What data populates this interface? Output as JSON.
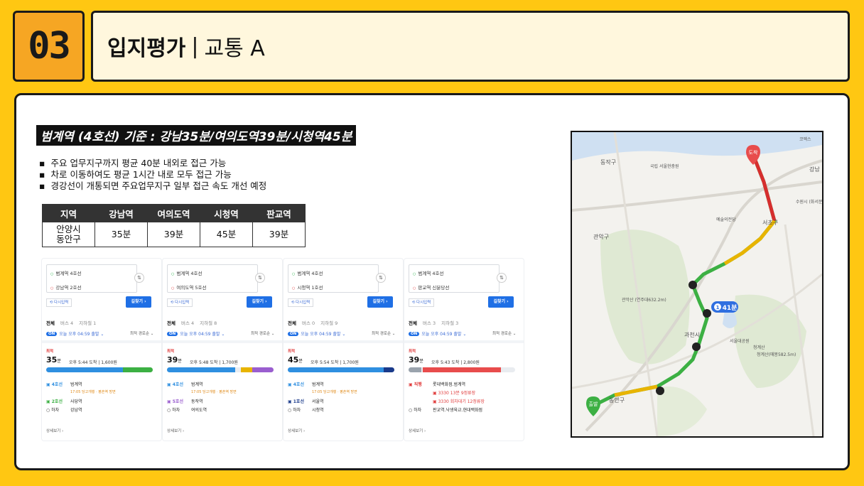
{
  "header": {
    "number": "03",
    "title_bold": "입지평가",
    "title_sep": "|",
    "title_light": "교통 A"
  },
  "headline": "범계역 (4호선) 기준 : 강남35분/여의도역39분/시청역45분",
  "bullets": [
    "주요 업무지구까지 평균 40분 내외로 접근 가능",
    "차로 이동하여도 평균 1시간 내로 모두 접근 가능",
    "경강선이 개통되면 주요업무지구 일부 접근 속도 개선 예정"
  ],
  "table": {
    "headers": [
      "지역",
      "강남역",
      "여의도역",
      "시청역",
      "판교역"
    ],
    "row": {
      "region_line1": "안양시",
      "region_line2": "동안구",
      "values": [
        "35분",
        "39분",
        "45분",
        "39분"
      ]
    }
  },
  "cards": [
    {
      "from": "범계역 4호선",
      "to": "강남역 2호선",
      "swap": "⇅",
      "retry": "⟲ 다시입력",
      "go": "길찾기 ›",
      "tabs": [
        "전체",
        "버스 4",
        "지하철 1"
      ],
      "depart_pill": "ON",
      "depart": "오늘 오후 04:59 출발 ⌄",
      "option": "최적 경로순 ⌄",
      "best": "최적",
      "duration": "35",
      "duration_unit": "분",
      "arrive": "오후 5:44 도착 | 1,600원",
      "stops": [
        {
          "line": "▣ 4호선",
          "name": "범계역",
          "sub": ""
        },
        {
          "line": "",
          "name": "",
          "sub": "17:05 당고개행 · 평촌역 방면"
        },
        {
          "line": "▣ 2호선",
          "name": "사당역",
          "sub": ""
        },
        {
          "line": "○ 하차",
          "name": "강남역",
          "sub": ""
        }
      ],
      "more": "상세보기 ›"
    },
    {
      "from": "범계역 4호선",
      "to": "여의도역 5호선",
      "swap": "⇅",
      "retry": "⟲ 다시입력",
      "go": "길찾기 ›",
      "tabs": [
        "전체",
        "버스 4",
        "지하철 8"
      ],
      "depart_pill": "ON",
      "depart": "오늘 오후 04:59 출발 ⌄",
      "option": "최적 경로순 ⌄",
      "best": "최적",
      "duration": "39",
      "duration_unit": "분",
      "arrive": "오후 5:48 도착 | 1,700원",
      "stops": [
        {
          "line": "▣ 4호선",
          "name": "범계역",
          "sub": ""
        },
        {
          "line": "",
          "name": "",
          "sub": "17:05 당고개행 · 평촌역 방면"
        },
        {
          "line": "▣ 5호선",
          "name": "동작역",
          "sub": ""
        },
        {
          "line": "○ 하차",
          "name": "여의도역",
          "sub": ""
        }
      ],
      "more": "상세보기 ›"
    },
    {
      "from": "범계역 4호선",
      "to": "시청역 1호선",
      "swap": "⇅",
      "retry": "⟲ 다시입력",
      "go": "길찾기 ›",
      "tabs": [
        "전체",
        "버스 0",
        "지하철 9"
      ],
      "depart_pill": "ON",
      "depart": "오늘 오후 04:59 출발 ⌄",
      "option": "최적 경로순 ⌄",
      "best": "최적",
      "duration": "45",
      "duration_unit": "분",
      "arrive": "오후 5:54 도착 | 1,700원",
      "stops": [
        {
          "line": "▣ 4호선",
          "name": "범계역",
          "sub": ""
        },
        {
          "line": "",
          "name": "",
          "sub": "17:05 당고개행 · 평촌역 방면"
        },
        {
          "line": "▣ 1호선",
          "name": "서울역",
          "sub": ""
        },
        {
          "line": "○ 하차",
          "name": "시청역",
          "sub": ""
        }
      ],
      "more": "상세보기 ›"
    },
    {
      "from": "범계역 4호선",
      "to": "판교역 신분당선",
      "swap": "⇅",
      "retry": "⟲ 다시입력",
      "go": "길찾기 ›",
      "tabs": [
        "전체",
        "버스 3",
        "지하철 3"
      ],
      "depart_pill": "ON",
      "depart": "오늘 오후 04:59 출발 ⌄",
      "option": "최적 경로순 ⌄",
      "best": "최적",
      "duration": "39",
      "duration_unit": "분",
      "arrive": "오후 5:43 도착 | 2,800원",
      "stops": [
        {
          "line": "▣ 직행",
          "name": "롯데백화점.범계역",
          "sub": ""
        },
        {
          "line": "",
          "name": "▣ 3330  13분 9정류장",
          "sub": ""
        },
        {
          "line": "",
          "name": "▣ 3330  회차대기 12정류장",
          "sub": ""
        },
        {
          "line": "○ 하차",
          "name": "판교역.낙생육교.현대백화점",
          "sub": ""
        }
      ],
      "more": "상세보기 ›"
    }
  ],
  "map": {
    "labels": [
      "동작구",
      "관악구",
      "서초구",
      "강남",
      "과천시",
      "동안구",
      "국립 서울현충원",
      "예술의전당",
      "청계산",
      "서울대공원",
      "관악산 (연주대632.2m)",
      "수원시 (화서문)",
      "청계산(매봉582.5m)",
      "코엑스"
    ],
    "time_badge": "41분",
    "time_badge_num": "1",
    "start_label": "출발",
    "end_label": "도착"
  },
  "colors": {
    "brand_yellow": "#FFC712",
    "num_orange": "#F6A623",
    "route_green": "#3CB043",
    "route_yellow": "#E8B400",
    "route_red": "#D62E2E"
  }
}
